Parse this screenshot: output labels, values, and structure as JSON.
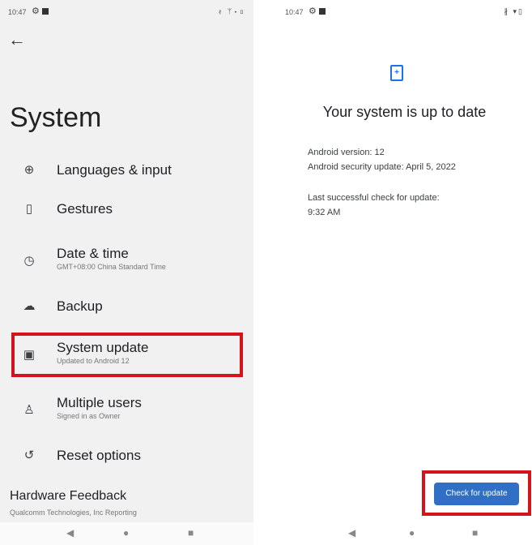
{
  "left": {
    "status_time": "10:47",
    "status_icons_right": "∦ ᛘ▾▯",
    "back_icon": "arrow-back",
    "title": "System",
    "items": [
      {
        "id": "languages",
        "icon": "globe-icon",
        "label": "Languages & input"
      },
      {
        "id": "gestures",
        "icon": "gestures-icon",
        "label": "Gestures"
      },
      {
        "id": "datetime",
        "icon": "clock-icon",
        "label": "Date & time",
        "sub": "GMT+08:00 China Standard Time"
      },
      {
        "id": "backup",
        "icon": "backup-icon",
        "label": "Backup"
      },
      {
        "id": "system-update",
        "icon": "system-update-icon",
        "label": "System update",
        "sub": "Updated to Android 12"
      },
      {
        "id": "multiple-users",
        "icon": "person-icon",
        "label": "Multiple users",
        "sub": "Signed in as Owner"
      },
      {
        "id": "reset",
        "icon": "history-icon",
        "label": "Reset options"
      }
    ],
    "hardware_title": "Hardware Feedback",
    "hardware_sub": "Qualcomm Technologies, Inc Reporting"
  },
  "right": {
    "status_time": "10:47",
    "status_icons_right": "∦ ▾▯",
    "heading": "Your system is up to date",
    "android_version": "Android version: 12",
    "security_update": "Android security update: April 5, 2022",
    "last_check_label": "Last successful check for update:",
    "last_check_time": "9:32 AM",
    "check_button": "Check for update"
  },
  "colors": {
    "highlight": "#d4131b",
    "accent": "#1a73e8",
    "button": "#2f6fc6"
  }
}
